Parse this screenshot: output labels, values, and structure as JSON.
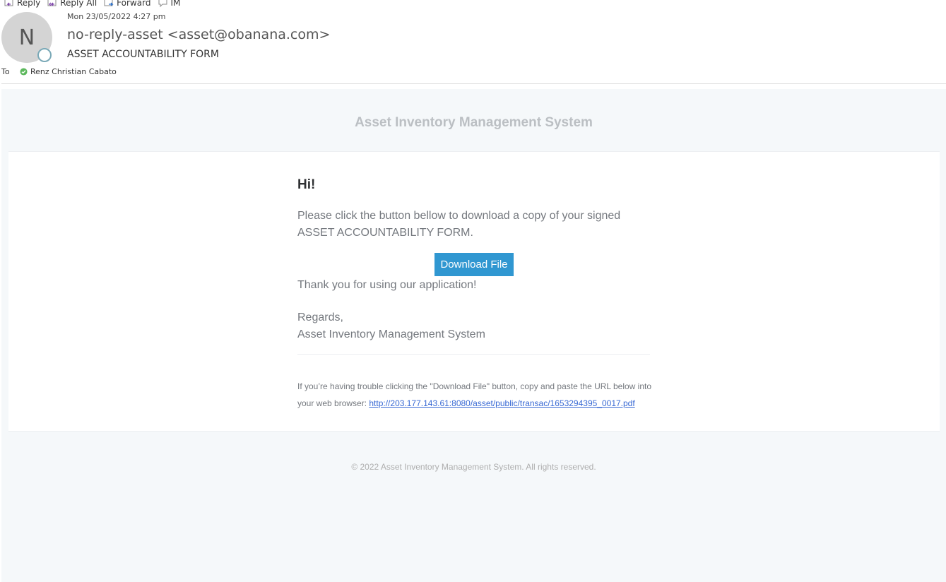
{
  "toolbar": {
    "reply": "Reply",
    "reply_all": "Reply All",
    "forward": "Forward",
    "im": "IM"
  },
  "message": {
    "avatar_initial": "N",
    "date": "Mon 23/05/2022 4:27 pm",
    "from": "no-reply-asset <asset@obanana.com>",
    "subject": "ASSET ACCOUNTABILITY FORM",
    "to_label": "To",
    "recipient": "Renz Christian Cabato"
  },
  "email": {
    "header_title": "Asset Inventory Management System",
    "greeting": "Hi!",
    "intro": "Please click the button bellow to download a copy of your signed ASSET ACCOUNTABILITY FORM.",
    "button_label": "Download File",
    "thanks": "Thank you for using our application!",
    "regards_line": "Regards,",
    "signature": "Asset Inventory Management System",
    "subcopy_prefix": "If you’re having trouble clicking the \"Download File\" button, copy and paste the URL below into your web browser: ",
    "url": "http://203.177.143.61:8080/asset/public/transac/1653294395_0017.pdf",
    "footer": "© 2022 Asset Inventory Management System. All rights reserved."
  },
  "colors": {
    "button": "#3097d1",
    "link": "#3869d4",
    "email_bg": "#f5f8fa",
    "presence_ring": "#7aa9b7",
    "recipient_check": "#5cb85c"
  }
}
